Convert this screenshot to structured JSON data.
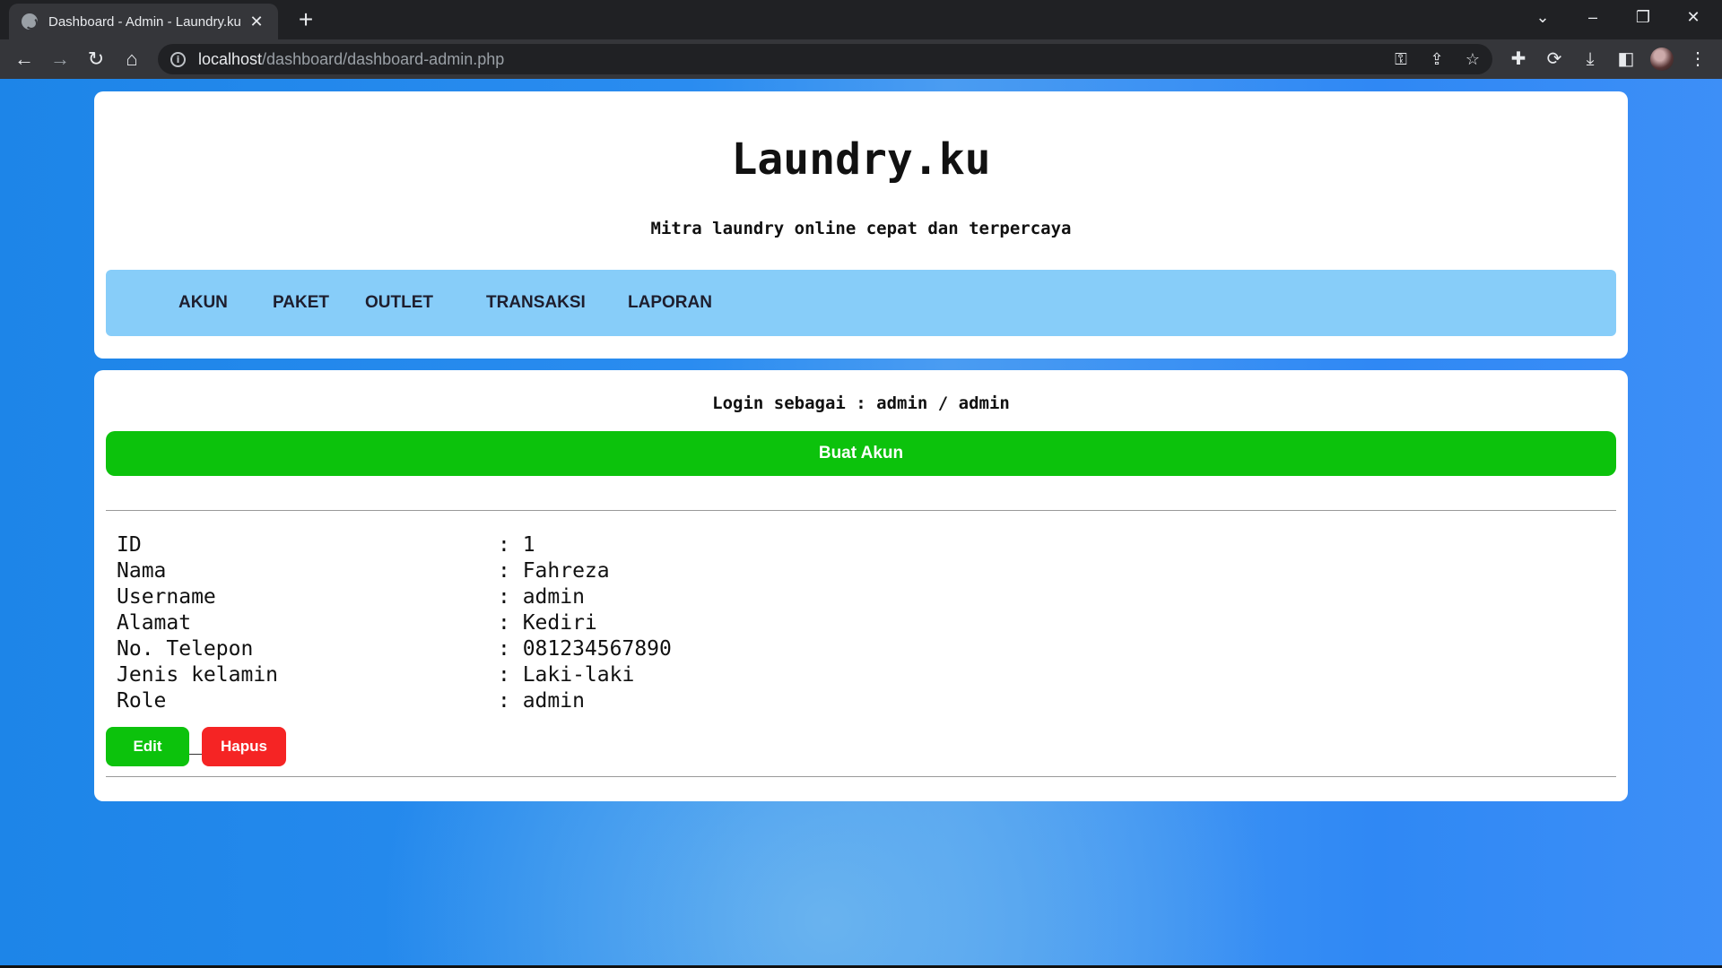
{
  "browser": {
    "tab_title": "Dashboard - Admin - Laundry.ku",
    "url_host": "localhost",
    "url_path": "/dashboard/dashboard-admin.php"
  },
  "header": {
    "title": "Laundry.ku",
    "tagline": "Mitra laundry online cepat dan terpercaya"
  },
  "nav": {
    "items": [
      "AKUN",
      "PAKET",
      "OUTLET",
      "TRANSAKSI",
      "LAPORAN"
    ]
  },
  "content": {
    "login_info": "Login sebagai : admin / admin",
    "create_button": "Buat Akun",
    "account": {
      "fields": [
        {
          "label": "ID",
          "value": ": 1"
        },
        {
          "label": "Nama",
          "value": ": Fahreza"
        },
        {
          "label": "Username",
          "value": ": admin"
        },
        {
          "label": "Alamat",
          "value": ": Kediri"
        },
        {
          "label": "No. Telepon",
          "value": ": 081234567890"
        },
        {
          "label": "Jenis kelamin",
          "value": ": Laki-laki"
        },
        {
          "label": "Role",
          "value": ": admin"
        }
      ]
    },
    "edit_button": "Edit",
    "delete_button": "Hapus"
  },
  "colors": {
    "page_background": "#1e88e5",
    "navbar": "#87cdf9",
    "create_button": "#0cc20c",
    "edit_button": "#0cc20c",
    "delete_button": "#f52424"
  },
  "icons": [
    "globe-icon",
    "close-icon",
    "plus-icon",
    "chevron-down-icon",
    "minimize-icon",
    "restore-icon",
    "back-icon",
    "forward-icon",
    "reload-icon",
    "home-icon",
    "info-icon",
    "key-icon",
    "share-icon",
    "star-icon",
    "puzzle-icon",
    "sync-icon",
    "download-icon",
    "sidepanel-icon",
    "menu-icon"
  ]
}
